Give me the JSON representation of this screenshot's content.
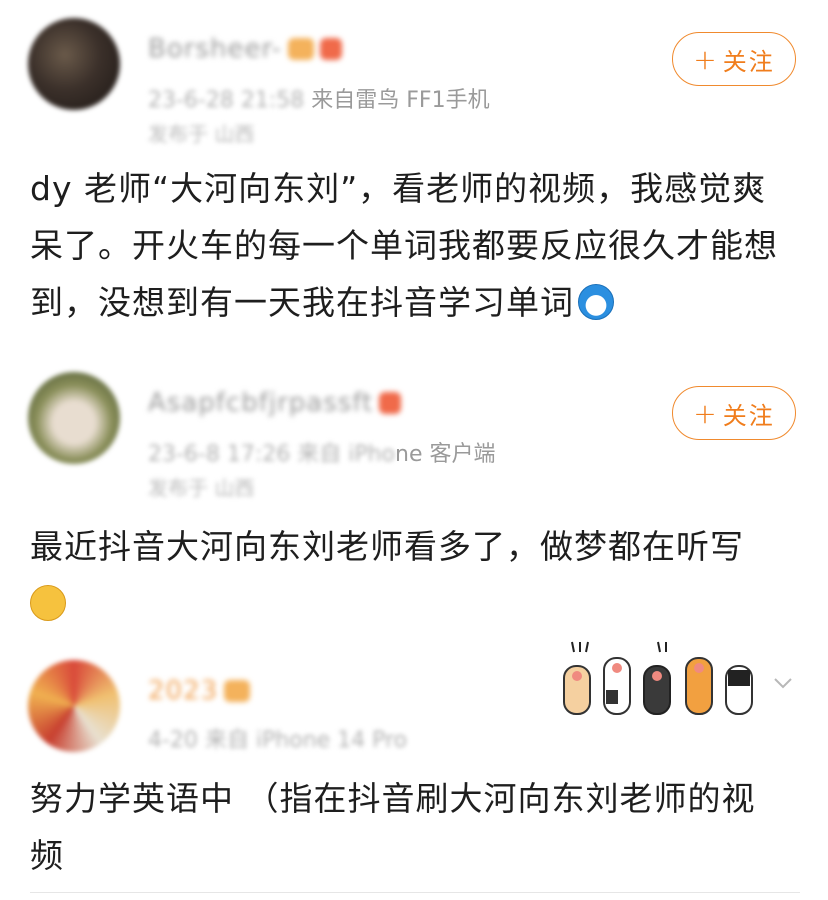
{
  "comments": [
    {
      "username": "Borsheer-",
      "time": "23-6-28 21:58",
      "source": "来自雷鸟 FF1手机",
      "ip": "发布于 山西",
      "follow_label": "关注",
      "content_lines": [
        "dy 老师“大河向东刘”，看老师的视频，我感觉爽",
        "呆了。开火车的每一个单词我都要反应很久才能想",
        "到，没想到有一天我在抖音学习单词"
      ],
      "emoji": "doraemon-icon"
    },
    {
      "username": "Asapfcbfjrpassft",
      "time": "23-6-8 17:26",
      "source_prefix": "来自 iPho",
      "source": "ne 客户端",
      "ip": "发布于 山西",
      "follow_label": "关注",
      "content_lines": [
        "最近抖音大河向东刘老师看多了，做梦都在听写"
      ],
      "emoji": "smirk-face-icon"
    },
    {
      "username": "2023",
      "time": "4-20",
      "source": "来自 iPhone 14 Pro",
      "content_lines": [
        "努力学英语中 （指在抖音刷大河向东刘老师的视",
        "频"
      ],
      "decoration": "cat-paws-sticker"
    }
  ],
  "colors": {
    "accent": "#f07d1c",
    "text": "#1e1e1e",
    "meta": "#b2b2b2"
  }
}
